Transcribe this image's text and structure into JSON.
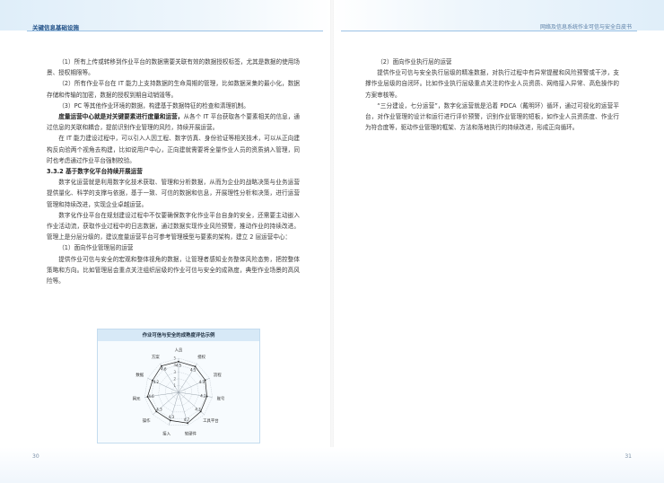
{
  "header": {
    "left_title": "关键信息基础设施",
    "right_title": "网络及信息系统作业可信与安全白皮书"
  },
  "pages": {
    "left_number": "30",
    "right_number": "31"
  },
  "left_column": {
    "p1": "（1）所有上传或转移到作业平台的数据需要关联有效的数据授权标签，尤其是数据的使用场景、授权期限等。",
    "p2": "（2）所有作业平台在 IT 能力上支持数据的生命周期的管理，比如数据采集的最小化，数据存储和传输的加密，数据的授权到期自动销毁等。",
    "p3": "（3）PC 等其他作业环境的数据，构建基于数据特征的检查和清理机制。",
    "p4_bold": "度量运营中心就是对关键要素进行度量和运营，",
    "p4_rest": "从各个 IT 平台获取各个要素相关的信息，通过信息的关联和耦合，提前识别作业管理的风险，持续开展运营。",
    "p5": "在 IT 能力建设过程中，可以引入人因工程、数字仿真、身份验证等相关技术，可以从正向建构反向验两个视角去构建，比如说用户中心，正向建就需要将全量作业人员的资质纳入管理，同时也考虑通过作业平台强制校验。",
    "heading": "3.3.2 基于数字化平台持续开展运营",
    "p6": "数字化运营就是利用数字化技术获取、管理和分析数据，从而为企业的战略决策与业务运营提供量化、科学的支撑与依据，基于一致、可信的数据和信息，开展理性分析和决策，进行运营管理和持续改进，实现企业卓越运营。",
    "p7": "数字化作业平台在规划建设过程中不仅要确保数字化作业平台自身的安全，还需要主动嵌入作业活动流，获取作业过程中的日志数据，通过数据实现作业风险预警，推动作业的持续改进。管理上是分层分级的，建议度量运营平台可参考管理模型与要素的架构，建立 2 层运营中心：",
    "p8": "（1）面向作业管理层的运营",
    "p9": "提供作业可信与安全的宏观和整体视角的数据，让管理者感知业务整体风险态势，把控整体策略和方向。比如管理层会重点关注组织层级的作业可信与安全的成熟度，典型作业场景的高风险等。"
  },
  "right_column": {
    "p1": "（2）面向作业执行层的运营",
    "p2": "提供作业可信与安全执行层级的精准数据，对执行过程中有异常提醒和风险预警或干涉，支撑作业层级的自闭环。比如作业执行层级重点关注的作业人员资质、网络接入异常、高危操作的方案审核等。",
    "p3": "“三分建设，七分运营”，数字化运营就是沿着 PDCA（戴明环）循环，通过可视化的运营平台，对作业管理的设计和运行进行评价预警，识别作业管理的短板，如作业人员资质度、作业行为符合度等，驱动作业管理的框架、方法和落地执行的持续改进，形成正向循环。"
  },
  "chart_data": {
    "type": "radar",
    "title": "作业可信与安全的成熟度评估示例",
    "rlim": [
      0,
      5
    ],
    "r_ticks": [
      "1",
      "2",
      "3",
      "4",
      "5"
    ],
    "axes": [
      "人员",
      "授权",
      "流程",
      "账号",
      "工具平台",
      "软硬件",
      "接入",
      "操作",
      "网元",
      "数据",
      "方案"
    ],
    "values": [
      4.5,
      4.5,
      4.3,
      4.2,
      4.3,
      4.7,
      4.3,
      4.3,
      4.6,
      4.2,
      4.6
    ],
    "value_labels": [
      "4.5",
      "4.5",
      "4.3",
      "4.2",
      "4.3",
      "4.7",
      "4.3",
      "4.3",
      "4.6",
      "4.2",
      "4.6"
    ],
    "colors": {
      "axis": "#9aa4ad",
      "series": "#222222"
    }
  }
}
